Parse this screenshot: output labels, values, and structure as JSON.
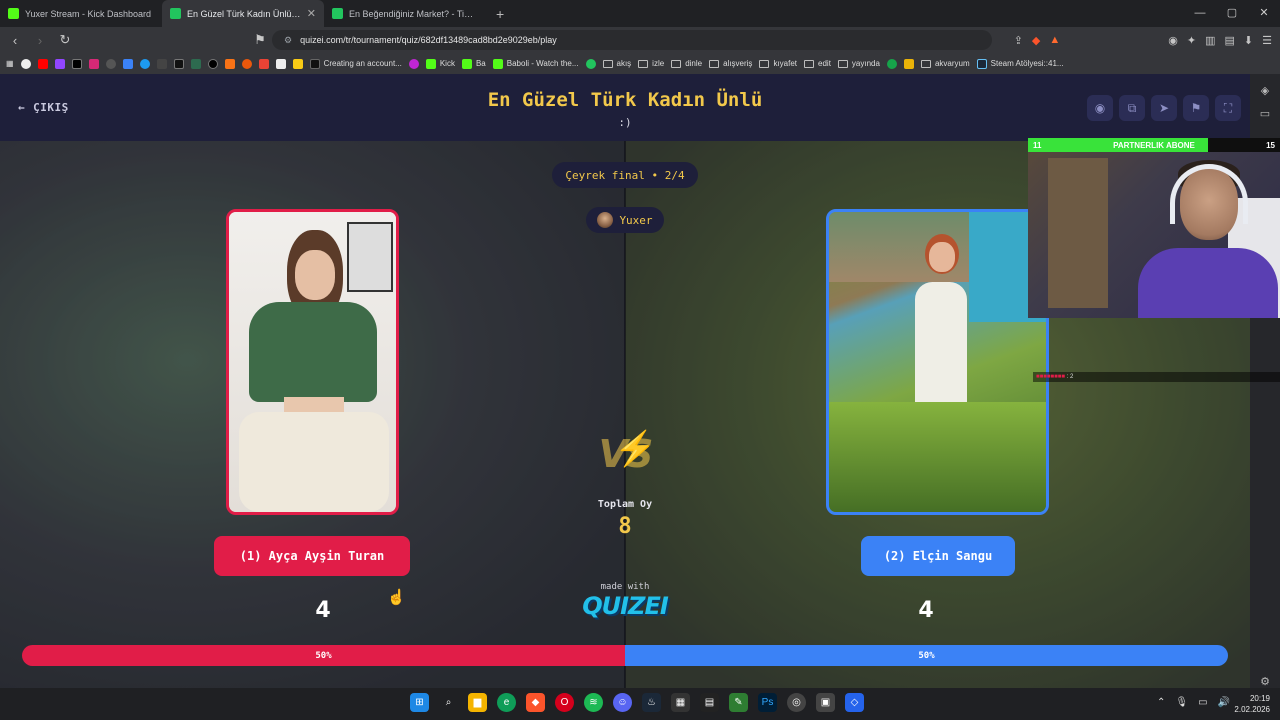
{
  "browser": {
    "tabs": [
      {
        "title": "Yuxer Stream - Kick Dashboard",
        "color": "#53fc18",
        "active": false
      },
      {
        "title": "En Güzel Türk Kadın Ünlü - Tier L",
        "color": "#22c55e",
        "active": true
      },
      {
        "title": "En Beğendiğiniz Market? - Tier List |",
        "color": "#22c55e",
        "active": false
      }
    ],
    "url": "quizei.com/tr/tournament/quiz/682df13489cad8bd2e9029eb/play",
    "bookmarks": [
      "Creating an account...",
      "Kick",
      "Ba",
      "Baboli - Watch the...",
      "akış",
      "izle",
      "dinle",
      "alışveriş",
      "kıyafet",
      "edit",
      "yayında",
      "akvaryum",
      "Steam Atölyesi::41..."
    ]
  },
  "quiz": {
    "back_label": "ÇIKIŞ",
    "title": "En Güzel Türk Kadın Ünlü",
    "subtitle": ":)",
    "round": "Çeyrek final • 2/4",
    "host": "Yuxer",
    "vs_label": "VS",
    "total_label": "Toplam Oy",
    "total_votes": "8",
    "made_with": "made with",
    "brand": "QUIZEI",
    "left": {
      "name": "(1) Ayça Ayşin Turan",
      "votes": "4",
      "percent_label": "50%",
      "share": 0.5,
      "color": "#e11d48"
    },
    "right": {
      "name": "(2) Elçin Sangu",
      "votes": "4",
      "percent_label": "50%",
      "share": 0.5,
      "color": "#3b82f6"
    }
  },
  "overlay": {
    "left_count": "11",
    "label": "PARTNERLIK ABONE",
    "right_count": "15",
    "chat_line": ": 2"
  },
  "taskbar": {
    "time": "20:19",
    "date": "2.02.2026"
  }
}
